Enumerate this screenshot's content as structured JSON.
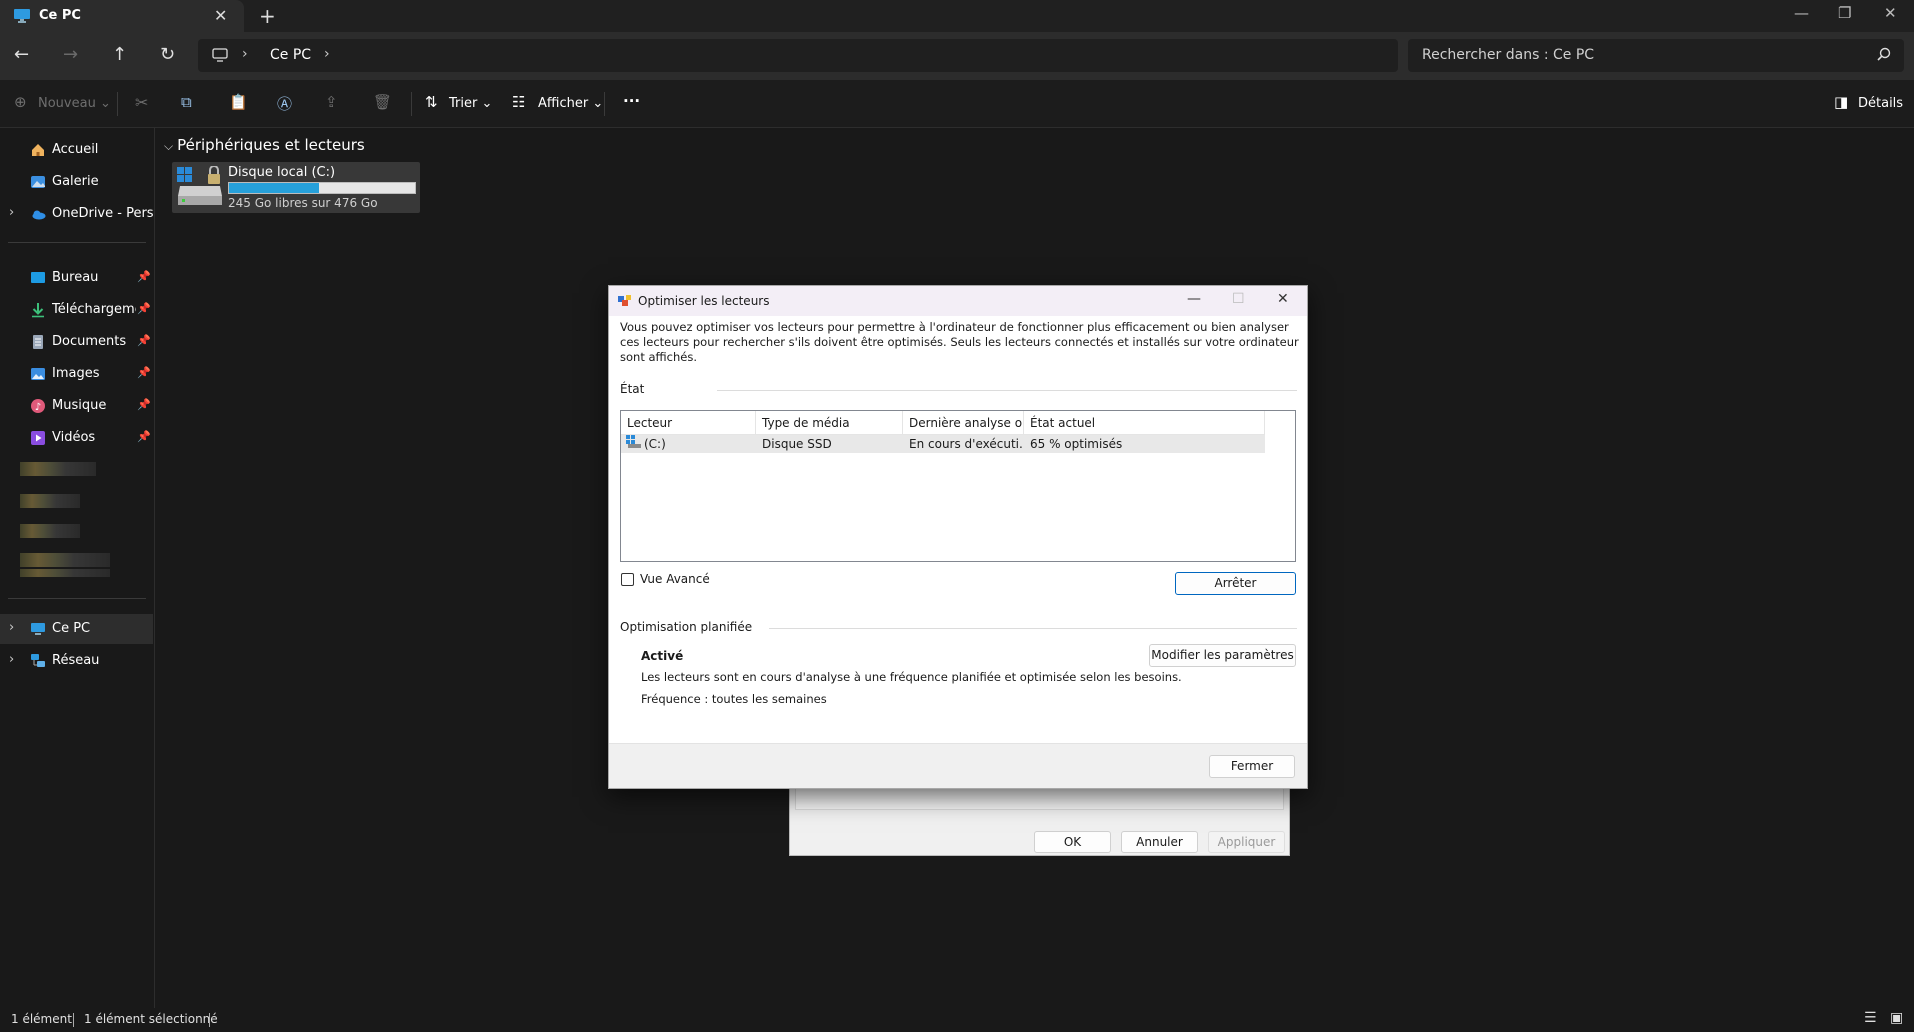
{
  "tab": {
    "title": "Ce PC"
  },
  "window": {
    "minimize": "—",
    "maximize": "❐",
    "close": "✕"
  },
  "address": {
    "crumb": "Ce PC",
    "search_placeholder": "Rechercher dans : Ce PC"
  },
  "toolbar": {
    "new": "Nouveau",
    "sort": "Trier",
    "view": "Afficher",
    "more": "···",
    "details": "Détails"
  },
  "sidebar": {
    "quick": [
      {
        "label": "Accueil"
      },
      {
        "label": "Galerie"
      },
      {
        "label": "OneDrive - Personal"
      }
    ],
    "pinned": [
      {
        "label": "Bureau"
      },
      {
        "label": "Téléchargements"
      },
      {
        "label": "Documents"
      },
      {
        "label": "Images"
      },
      {
        "label": "Musique"
      },
      {
        "label": "Vidéos"
      }
    ],
    "bottom": [
      {
        "label": "Ce PC"
      },
      {
        "label": "Réseau"
      }
    ]
  },
  "main": {
    "group_title": "Périphériques et lecteurs",
    "drive": {
      "name": "Disque local (C:)",
      "free_text": "245 Go libres sur 476 Go",
      "used_fraction": 0.485
    }
  },
  "statusbar": {
    "count": "1 élément",
    "selected": "1 élément sélectionné"
  },
  "back_dialog": {
    "ok": "OK",
    "cancel": "Annuler",
    "apply": "Appliquer"
  },
  "dialog": {
    "title": "Optimiser les lecteurs",
    "description": "Vous pouvez optimiser vos lecteurs pour permettre à l'ordinateur de fonctionner plus efficacement ou bien analyser ces lecteurs pour rechercher s'ils doivent être optimisés. Seuls les lecteurs connectés et installés sur votre ordinateur sont affichés.",
    "status_section": "État",
    "columns": [
      "Lecteur",
      "Type de média",
      "Dernière analyse o...",
      "État actuel"
    ],
    "rows": [
      {
        "drive": "(C:)",
        "media": "Disque SSD",
        "last": "En cours d'exécuti...",
        "state": "65 % optimisés"
      }
    ],
    "advanced_view": "Vue Avancé",
    "stop": "Arrêter",
    "scheduled_section": "Optimisation planifiée",
    "scheduled_status": "Activé",
    "scheduled_desc": "Les lecteurs sont en cours d'analyse à une fréquence planifiée et optimisée selon les besoins.",
    "frequency": "Fréquence : toutes les semaines",
    "change_settings": "Modifier les paramètres",
    "close": "Fermer"
  }
}
